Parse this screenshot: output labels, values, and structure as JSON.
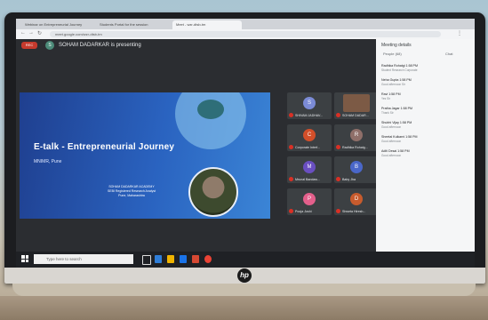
{
  "browser": {
    "tabs": [
      {
        "label": "Webinar on Entrepreneurial Journey"
      },
      {
        "label": "Students Portal for the session"
      },
      {
        "label": "Meet - wzr-dtsb-tm"
      }
    ],
    "url": "meet.google.com/wzr-dtsb-tm"
  },
  "meet": {
    "record_badge": "REC",
    "presenter_initial": "S",
    "presenting_text": "SOHAM DADARKAR is presenting",
    "slide": {
      "title": "E-talk - Entrepreneurial Journey",
      "subtitle": "MNIMR, Pune",
      "org_line1": "SOHAM DADARKAR ACADEMY",
      "org_line2": "SEBI Registered Research Analyst",
      "org_line3": "Pune, Maharashtra"
    },
    "tiles": [
      {
        "initial": "S",
        "color": "#7b8bd6",
        "name": "SHIVAM JADHAV..."
      },
      {
        "initial": "",
        "color": "#7c5a45",
        "name": "SOHAM DADAR..."
      },
      {
        "initial": "C",
        "color": "#d24f2a",
        "name": "Corporate Interf..."
      },
      {
        "initial": "R",
        "color": "#8f6f69",
        "name": "Radhika Rohatg..."
      },
      {
        "initial": "M",
        "color": "#6a4fc1",
        "name": "Mrunal Bandaw..."
      },
      {
        "initial": "B",
        "color": "#4a67c9",
        "name": "Baby Jha"
      },
      {
        "initial": "P",
        "color": "#e35f8b",
        "name": "Pooja Joshi"
      },
      {
        "initial": "D",
        "color": "#c75b2d",
        "name": "Shweta Hiresh..."
      }
    ],
    "meeting_details": "Meeting details",
    "panel": {
      "title": "Meeting details",
      "tab_people": "People (68)",
      "tab_chat": "Chat",
      "people": [
        {
          "name": "Radhika Rohatgi  1:58 PM",
          "sub": "Student Research Corporate"
        },
        {
          "name": "Neha Gupta  1:58 PM",
          "sub": "Good afternoon Sir"
        },
        {
          "name": "Ravi  1:58 PM",
          "sub": "Yes Sir"
        },
        {
          "name": "Pratha Jagar  1:58 PM",
          "sub": "Thank Sir"
        },
        {
          "name": "Shubhi Vijay  1:58 PM",
          "sub": "Good afternoon"
        },
        {
          "name": "Sheetal Kulkarni  1:58 PM",
          "sub": "Good afternoon"
        },
        {
          "name": "Aditi Desai  1:58 PM",
          "sub": "Good afternoon"
        }
      ]
    }
  },
  "taskbar": {
    "search_placeholder": "Type here to search"
  },
  "laptop": {
    "brand": "hp"
  }
}
